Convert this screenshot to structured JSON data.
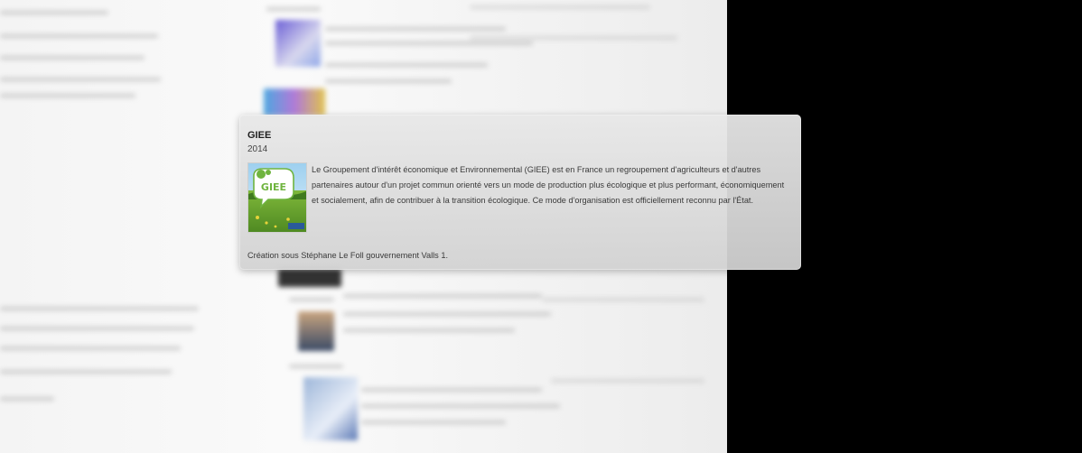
{
  "popup": {
    "title": "GIEE",
    "year": "2014",
    "description": "Le Groupement d'intérêt économique et Environnemental (GIEE) est en France un regroupement d'agriculteurs et d'autres partenaires autour d'un projet commun orienté vers un mode de production plus écologique et plus performant, économiquement et socialement, afin de contribuer à la transition écologique. Ce mode d'organisation est officiellement reconnu par l'État.",
    "footer": "Création sous Stéphane Le Foll gouvernement Valls 1.",
    "thumbnail": {
      "logo_text": "GIEE",
      "accent_color": "#6fb43f"
    }
  },
  "colors": {
    "background_right": "#000000",
    "page_background": "#f4f4f4",
    "card_background": "#dedede"
  }
}
